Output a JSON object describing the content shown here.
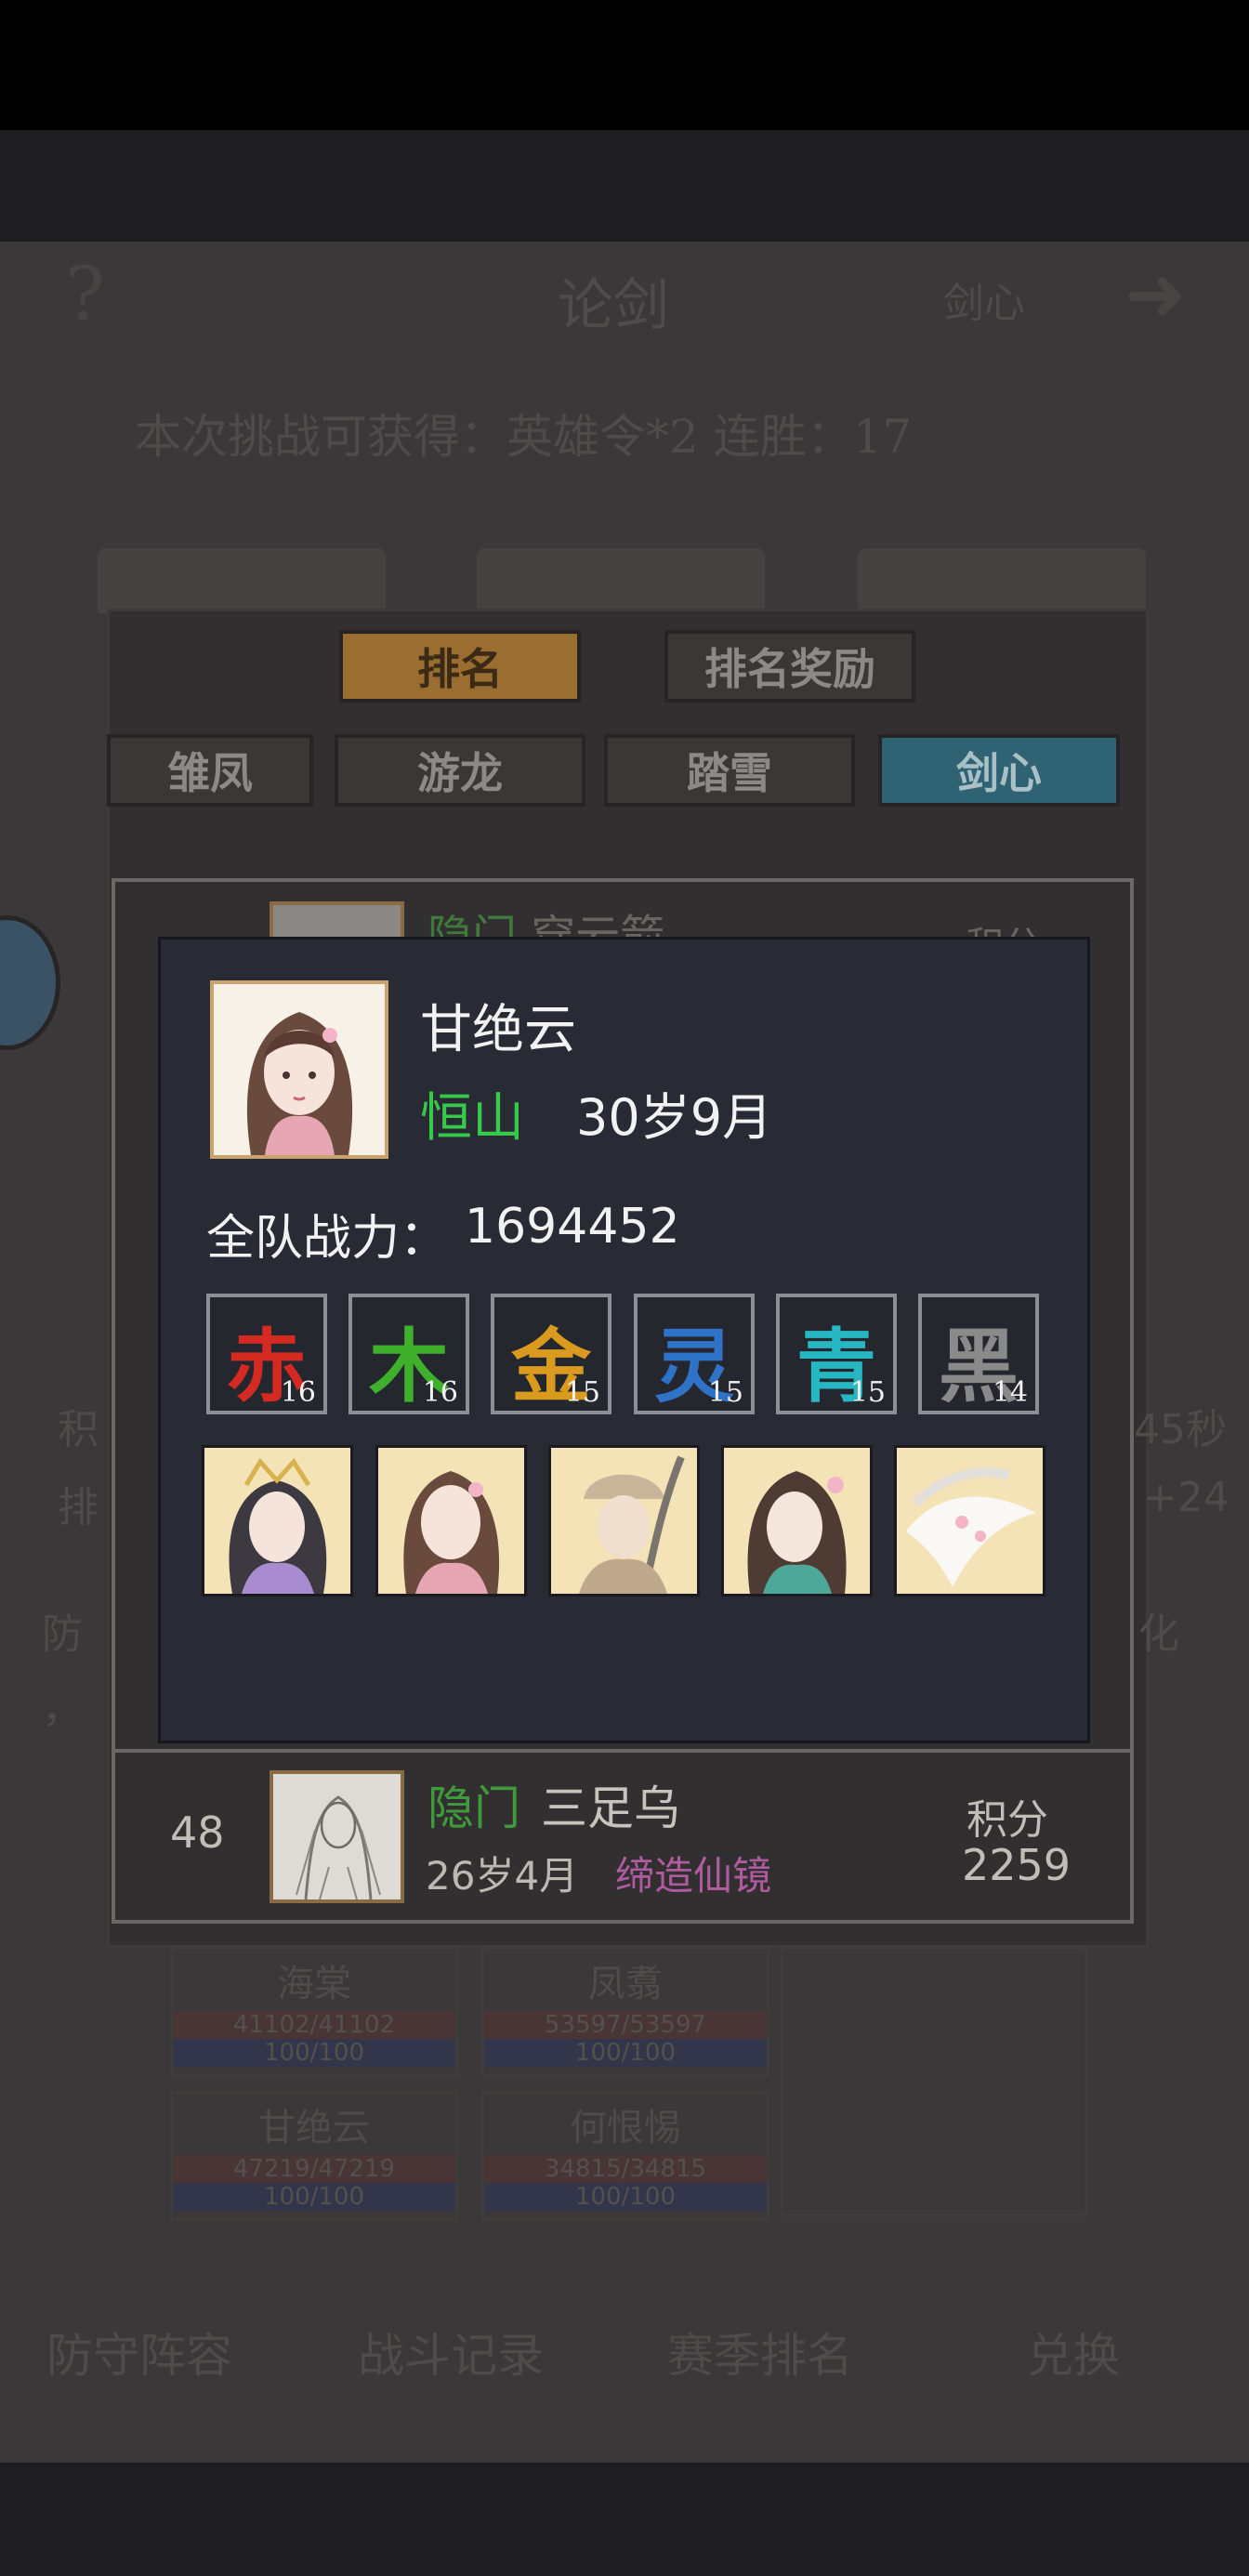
{
  "background": {
    "help_icon": "?",
    "title": "论剑",
    "right_tab": "剑心",
    "arrow_icon": "➜",
    "reward_text": "本次挑战可获得：英雄令*2   连胜：17",
    "tabs": [
      "排名",
      "排名奖励"
    ],
    "subtabs": [
      "雏凤",
      "游龙",
      "踏雪",
      "剑心"
    ],
    "row_top": {
      "sect": "隐门",
      "name": "穿云箭",
      "score_label": "积分"
    },
    "row_48": {
      "rank": "48",
      "sect": "隐门",
      "name": "三足乌",
      "age": "26岁4月",
      "skill": "缔造仙镜",
      "score_label": "积分",
      "score": "2259"
    },
    "side_left": [
      "积",
      "排",
      "防",
      "，"
    ],
    "side_right": [
      "45秒",
      "+24",
      "化"
    ],
    "hero_cards": [
      {
        "name": "海棠",
        "hp": "41102/41102",
        "mp": "100/100"
      },
      {
        "name": "凤翥",
        "hp": "53597/53597",
        "mp": "100/100"
      },
      {
        "name": "甘绝云",
        "hp": "47219/47219",
        "mp": "100/100"
      },
      {
        "name": "何恨惕",
        "hp": "34815/34815",
        "mp": "100/100"
      }
    ],
    "bottom_nav": [
      "防守阵容",
      "战斗记录",
      "赛季排名",
      "兑换"
    ]
  },
  "popup": {
    "name": "甘绝云",
    "sect": "恒山",
    "age": "30岁9月",
    "power_label": "全队战力：",
    "power": "1694452",
    "elements": [
      {
        "char": "赤",
        "level": "16",
        "color": "#d42a22"
      },
      {
        "char": "木",
        "level": "16",
        "color": "#3fb02c"
      },
      {
        "char": "金",
        "level": "15",
        "color": "#d99a1e"
      },
      {
        "char": "灵",
        "level": "15",
        "color": "#2f73c9"
      },
      {
        "char": "青",
        "level": "15",
        "color": "#27b7c2"
      },
      {
        "char": "黑",
        "level": "14",
        "color": "#8a8a8a"
      }
    ],
    "team_portraits": [
      "crowned-woman",
      "flower-hair-woman",
      "fur-hat-swordsman",
      "flower-bun-woman",
      "white-crane"
    ]
  }
}
